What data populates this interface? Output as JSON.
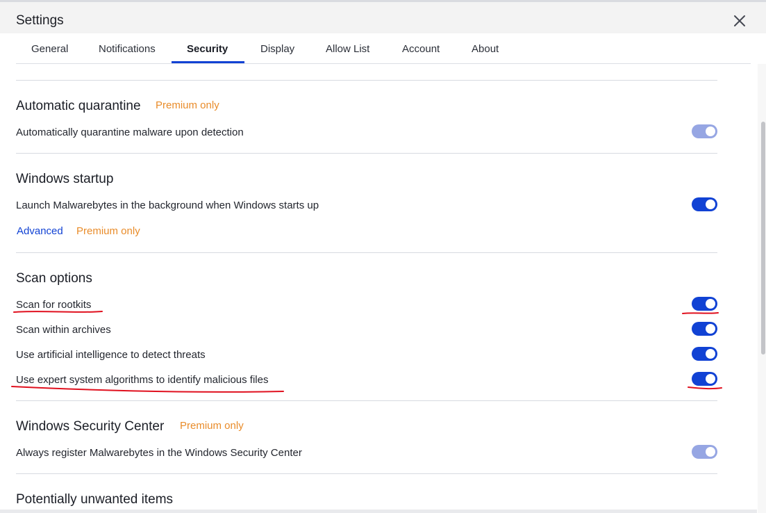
{
  "window": {
    "title": "Settings",
    "close_icon": "close-icon"
  },
  "tabs": [
    {
      "label": "General",
      "active": false
    },
    {
      "label": "Notifications",
      "active": false
    },
    {
      "label": "Security",
      "active": true
    },
    {
      "label": "Display",
      "active": false
    },
    {
      "label": "Allow List",
      "active": false
    },
    {
      "label": "Account",
      "active": false
    },
    {
      "label": "About",
      "active": false
    }
  ],
  "sections": {
    "quarantine": {
      "heading": "Automatic quarantine",
      "badge": "Premium only",
      "option": {
        "label": "Automatically quarantine malware upon detection",
        "enabled": true,
        "disabled": true
      }
    },
    "startup": {
      "heading": "Windows startup",
      "option": {
        "label": "Launch Malwarebytes in the background when Windows starts up",
        "enabled": true
      },
      "advanced_link": "Advanced",
      "advanced_badge": "Premium only"
    },
    "scan": {
      "heading": "Scan options",
      "options": [
        {
          "label": "Scan for rootkits",
          "enabled": true
        },
        {
          "label": "Scan within archives",
          "enabled": true
        },
        {
          "label": "Use artificial intelligence to detect threats",
          "enabled": true
        },
        {
          "label": "Use expert system algorithms to identify malicious files",
          "enabled": true
        }
      ]
    },
    "security_center": {
      "heading": "Windows Security Center",
      "badge": "Premium only",
      "option": {
        "label": "Always register Malwarebytes in the Windows Security Center",
        "enabled": true,
        "disabled": true
      }
    },
    "pup": {
      "heading": "Potentially unwanted items"
    }
  },
  "colors": {
    "accent": "#1142d4",
    "premium": "#e98c2a",
    "toggle_disabled": "#96a6e3",
    "annotation": "#e0101e"
  }
}
